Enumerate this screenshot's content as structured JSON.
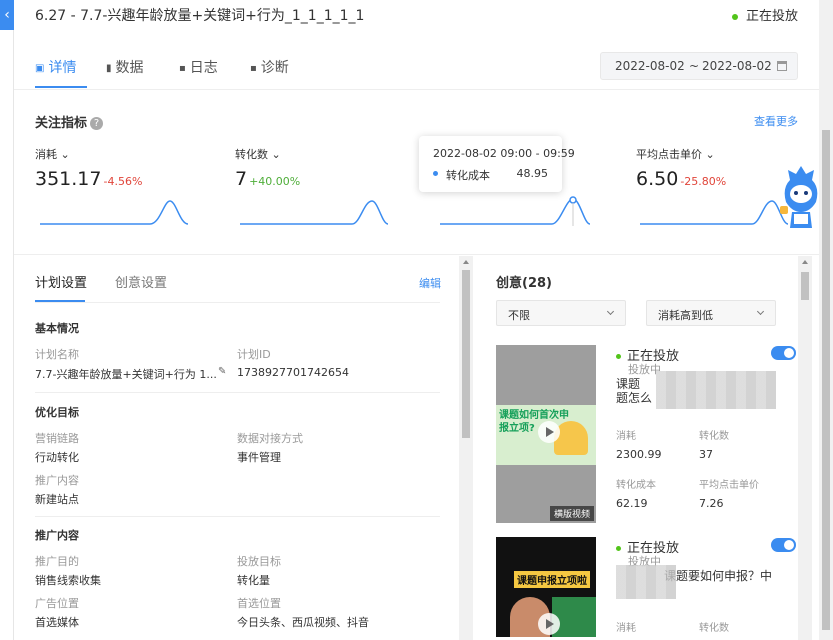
{
  "header": {
    "plan_title": "6.27 - 7.7-兴趣年龄放量+关键词+行为_1_1_1_1_1",
    "status": "正在投放"
  },
  "tabs": [
    {
      "label": "详情",
      "icon": "card-icon"
    },
    {
      "label": "数据",
      "icon": "bar-chart-icon"
    },
    {
      "label": "日志",
      "icon": "log-icon"
    },
    {
      "label": "诊断",
      "icon": "diagnose-icon"
    }
  ],
  "date_range": {
    "start": "2022-08-02",
    "sep": "~",
    "end": "2022-08-02"
  },
  "metrics": {
    "title": "关注指标",
    "more": "查看更多",
    "items": [
      {
        "label": "消耗",
        "value": "351.17",
        "change": "-4.56%"
      },
      {
        "label": "转化数",
        "value": "7",
        "change": "+40.00%"
      },
      {
        "label": "",
        "value": "",
        "change": ""
      },
      {
        "label": "平均点击单价",
        "value": "6.50",
        "change": "-25.80%"
      }
    ],
    "tooltip": {
      "time": "2022-08-02 09:00 - 09:59",
      "name": "转化成本",
      "value": "48.95"
    }
  },
  "plan": {
    "tabs": [
      "计划设置",
      "创意设置"
    ],
    "edit": "编辑",
    "basic": {
      "title": "基本情况",
      "name_label": "计划名称",
      "name_value": "7.7-兴趣年龄放量+关键词+行为 1...",
      "id_label": "计划ID",
      "id_value": "1738927701742654"
    },
    "goal": {
      "title": "优化目标",
      "chain_label": "营销链路",
      "chain_value": "行动转化",
      "dock_label": "数据对接方式",
      "dock_value": "事件管理",
      "content_label": "推广内容",
      "content_value": "新建站点"
    },
    "promo": {
      "title": "推广内容",
      "purpose_label": "推广目的",
      "purpose_value": "销售线索收集",
      "target_label": "投放目标",
      "target_value": "转化量",
      "pos_label": "广告位置",
      "pos_value": "首选媒体",
      "pref_label": "首选位置",
      "pref_value": "今日头条、西瓜视频、抖音"
    }
  },
  "creative": {
    "title": "创意(28)",
    "filter": "不限",
    "sort": "消耗高到低",
    "cards": [
      {
        "status": "正在投放",
        "sub": "投放中",
        "title_line1": "课题",
        "title_line2": "题怎么",
        "thumb_text": "课题如何首次申报立项?",
        "video_tag": "横版视频",
        "cost_label": "消耗",
        "cost": "2300.99",
        "conv_label": "转化数",
        "conv": "37",
        "cpa_label": "转化成本",
        "cpa": "62.19",
        "cpc_label": "平均点击单价",
        "cpc": "7.26"
      },
      {
        "status": "正在投放",
        "sub": "投放中",
        "title_line1": "课题要如何申报？中",
        "thumb_text": "课题申报立项啦",
        "cost_label": "消耗",
        "conv_label": "转化数"
      }
    ]
  },
  "colors": {
    "accent": "#3b8cf0",
    "positive": "#4fae3a",
    "negative": "#e0453a",
    "live": "#52c41a"
  }
}
